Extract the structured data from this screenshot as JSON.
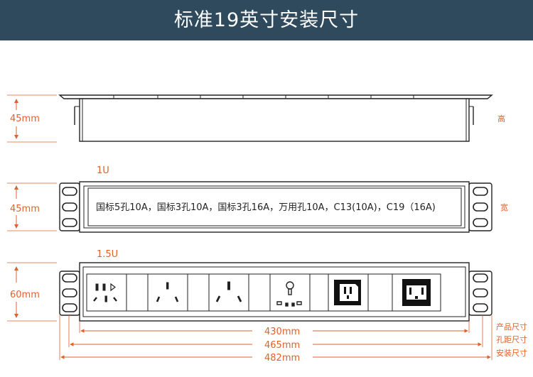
{
  "header": {
    "title": "标准19英寸安装尺寸"
  },
  "top_view": {
    "height_label": "45mm",
    "side_label": "高"
  },
  "front_1u": {
    "tag": "1U",
    "height_label": "45mm",
    "side_label": "宽",
    "panel_text": "国标5孔10A，国标3孔10A，国标3孔16A，万用孔10A，C13(10A)，C19（16A)"
  },
  "front_15u": {
    "tag": "1.5U",
    "height_label": "60mm"
  },
  "dimensions": {
    "product": "430mm",
    "hole": "465mm",
    "install": "482mm",
    "product_label": "产品尺寸",
    "hole_label": "孔距尺寸",
    "install_label": "安装尺寸"
  },
  "colors": {
    "header": "#2f4a5c",
    "accent": "#e0622b",
    "line": "#222222"
  }
}
